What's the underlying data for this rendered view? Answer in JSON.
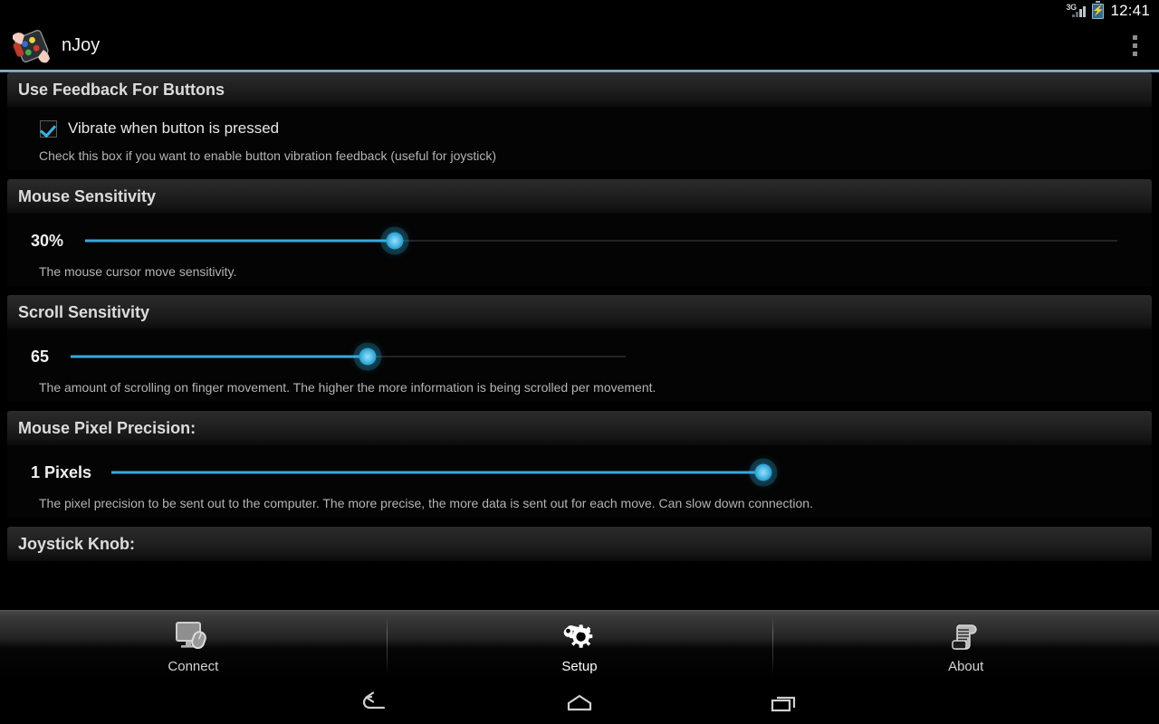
{
  "statusbar": {
    "network": "3G",
    "network_icon": "signal-3g-icon",
    "battery_icon": "battery-charging-icon",
    "time": "12:41"
  },
  "appbar": {
    "title": "nJoy",
    "icon": "njoy-app-icon",
    "overflow": "overflow-menu-icon"
  },
  "accent_color": "#33b5e5",
  "sections": [
    {
      "title": "Use Feedback For Buttons",
      "type": "checkbox",
      "checkbox": {
        "label": "Vibrate when button is pressed",
        "checked": true
      },
      "summary": "Check this box if you want to enable button vibration feedback (useful for joystick)"
    },
    {
      "title": "Mouse Sensitivity",
      "type": "slider",
      "slider": {
        "value_label": "30%",
        "fill_percent": 30
      },
      "summary": "The mouse cursor move sensitivity."
    },
    {
      "title": "Scroll Sensitivity",
      "type": "slider",
      "slider": {
        "value_label": "65",
        "fill_percent": 65
      },
      "summary": "The amount of scrolling on finger movement. The higher the more information is being scrolled per movement."
    },
    {
      "title": "Mouse Pixel Precision:",
      "type": "slider",
      "slider": {
        "value_label": "1 Pixels",
        "fill_percent": 100
      },
      "summary": "The pixel precision to be sent out to the computer. The more precise, the more data is sent out for each move. Can slow down connection."
    },
    {
      "title": "Joystick Knob:",
      "type": "header-only"
    }
  ],
  "tabs": [
    {
      "label": "Connect",
      "icon": "monitor-mouse-icon",
      "active": false
    },
    {
      "label": "Setup",
      "icon": "gear-wrench-icon",
      "active": true
    },
    {
      "label": "About",
      "icon": "scroll-document-icon",
      "active": false
    }
  ],
  "navbar": [
    {
      "name": "back-icon"
    },
    {
      "name": "home-icon"
    },
    {
      "name": "recents-icon"
    }
  ]
}
